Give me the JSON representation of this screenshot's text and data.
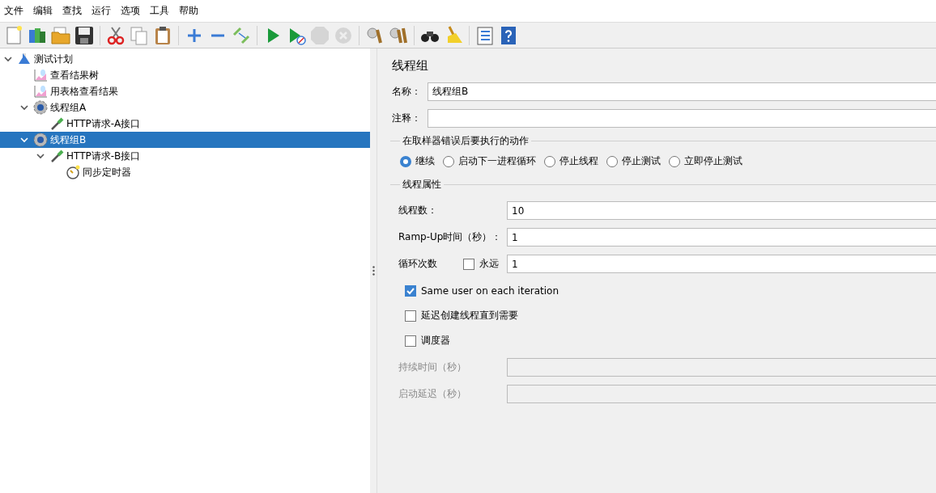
{
  "menu": [
    "文件",
    "编辑",
    "查找",
    "运行",
    "选项",
    "工具",
    "帮助"
  ],
  "toolbar": [
    {
      "kind": "new",
      "disabled": false
    },
    {
      "kind": "templates",
      "disabled": false
    },
    {
      "kind": "open",
      "disabled": false
    },
    {
      "kind": "save",
      "disabled": false
    },
    {
      "kind": "separator"
    },
    {
      "kind": "cut",
      "disabled": false
    },
    {
      "kind": "copy",
      "disabled": false
    },
    {
      "kind": "paste",
      "disabled": false
    },
    {
      "kind": "separator"
    },
    {
      "kind": "expand",
      "disabled": false
    },
    {
      "kind": "collapse",
      "disabled": false
    },
    {
      "kind": "toggle",
      "disabled": false
    },
    {
      "kind": "separator"
    },
    {
      "kind": "start",
      "disabled": false
    },
    {
      "kind": "start-no-timers",
      "disabled": false
    },
    {
      "kind": "stop",
      "disabled": true
    },
    {
      "kind": "shutdown",
      "disabled": true
    },
    {
      "kind": "separator"
    },
    {
      "kind": "clear",
      "disabled": false
    },
    {
      "kind": "clear-all",
      "disabled": false
    },
    {
      "kind": "separator"
    },
    {
      "kind": "search",
      "disabled": false
    },
    {
      "kind": "reset-search",
      "disabled": false
    },
    {
      "kind": "separator"
    },
    {
      "kind": "functions",
      "disabled": false
    },
    {
      "kind": "help",
      "disabled": false
    }
  ],
  "tree": [
    {
      "label": "测试计划",
      "kind": "plan",
      "expanded": true,
      "selected": false,
      "children": [
        {
          "label": "查看结果树",
          "kind": "listener",
          "selected": false
        },
        {
          "label": "用表格查看结果",
          "kind": "listener",
          "selected": false
        },
        {
          "label": "线程组A",
          "kind": "threadgroup",
          "expanded": true,
          "selected": false,
          "children": [
            {
              "label": "HTTP请求-A接口",
              "kind": "sampler",
              "selected": false
            }
          ]
        },
        {
          "label": "线程组B",
          "kind": "threadgroup",
          "expanded": true,
          "selected": true,
          "children": [
            {
              "label": "HTTP请求-B接口",
              "kind": "sampler",
              "expanded": true,
              "selected": false,
              "children": [
                {
                  "label": "同步定时器",
                  "kind": "timer",
                  "selected": false
                }
              ]
            }
          ]
        }
      ]
    }
  ],
  "panel": {
    "title": "线程组",
    "name_field": {
      "label": "名称：",
      "value": "线程组B"
    },
    "comment_field": {
      "label": "注释："
    },
    "error_action": {
      "title": "在取样器错误后要执行的动作",
      "options": [
        {
          "label": "继续",
          "selected": true
        },
        {
          "label": "启动下一进程循环",
          "selected": false
        },
        {
          "label": "停止线程",
          "selected": false
        },
        {
          "label": "停止测试",
          "selected": false
        },
        {
          "label": "立即停止测试",
          "selected": false
        }
      ]
    },
    "thread_properties": {
      "title": "线程属性",
      "rows": [
        {
          "kind": "field",
          "label": "线程数：",
          "value": "10",
          "disabled": false
        },
        {
          "kind": "field",
          "label": "Ramp-Up时间（秒）：",
          "value": "1",
          "disabled": false
        },
        {
          "kind": "loop",
          "label": "循环次数",
          "checkbox": {
            "label": "永远",
            "checked": false
          },
          "value": "1",
          "disabled": false
        },
        {
          "kind": "checkbox",
          "label": "Same user on each iteration",
          "checked": true
        },
        {
          "kind": "checkbox",
          "label": "延迟创建线程直到需要",
          "checked": false
        },
        {
          "kind": "checkbox",
          "label": "调度器",
          "checked": false
        },
        {
          "kind": "field",
          "label": "持续时间（秒）",
          "value": "",
          "disabled": true
        },
        {
          "kind": "field",
          "label": "启动延迟（秒）",
          "value": "",
          "disabled": true
        }
      ]
    }
  }
}
